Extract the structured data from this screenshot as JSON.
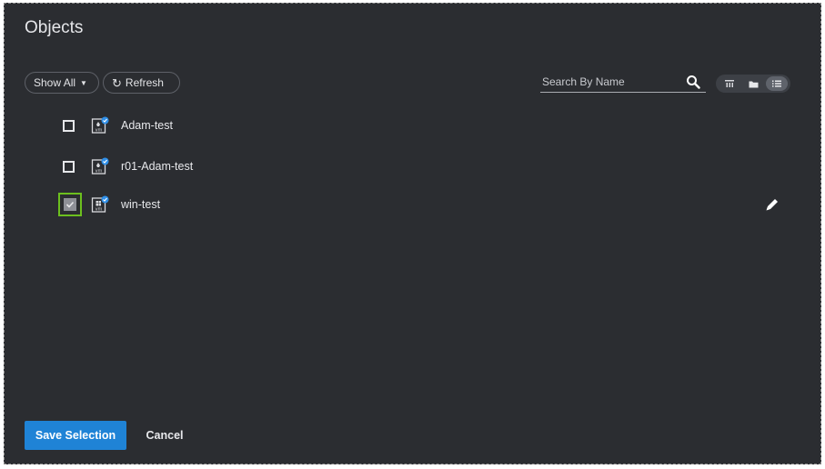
{
  "dialog": {
    "title": "Objects"
  },
  "toolbar": {
    "filter_label": "Show All",
    "refresh_label": "Refresh"
  },
  "search": {
    "placeholder": "Search By Name",
    "value": ""
  },
  "view_modes": [
    {
      "icon": "tree-view-icon",
      "active": false
    },
    {
      "icon": "folder-view-icon",
      "active": false
    },
    {
      "icon": "list-view-icon",
      "active": true
    }
  ],
  "objects": [
    {
      "name": "Adam-test",
      "icon": "vm-linux-icon",
      "checked": false
    },
    {
      "name": "r01-Adam-test",
      "icon": "vm-linux-icon",
      "checked": false
    },
    {
      "name": "win-test",
      "icon": "vm-windows-icon",
      "checked": true
    }
  ],
  "footer": {
    "save_label": "Save Selection",
    "cancel_label": "Cancel"
  },
  "colors": {
    "background": "#2b2d31",
    "primary": "#1f83d6",
    "checked_outline": "#6cbf1e",
    "vm_badge": "#2f8fe8"
  }
}
